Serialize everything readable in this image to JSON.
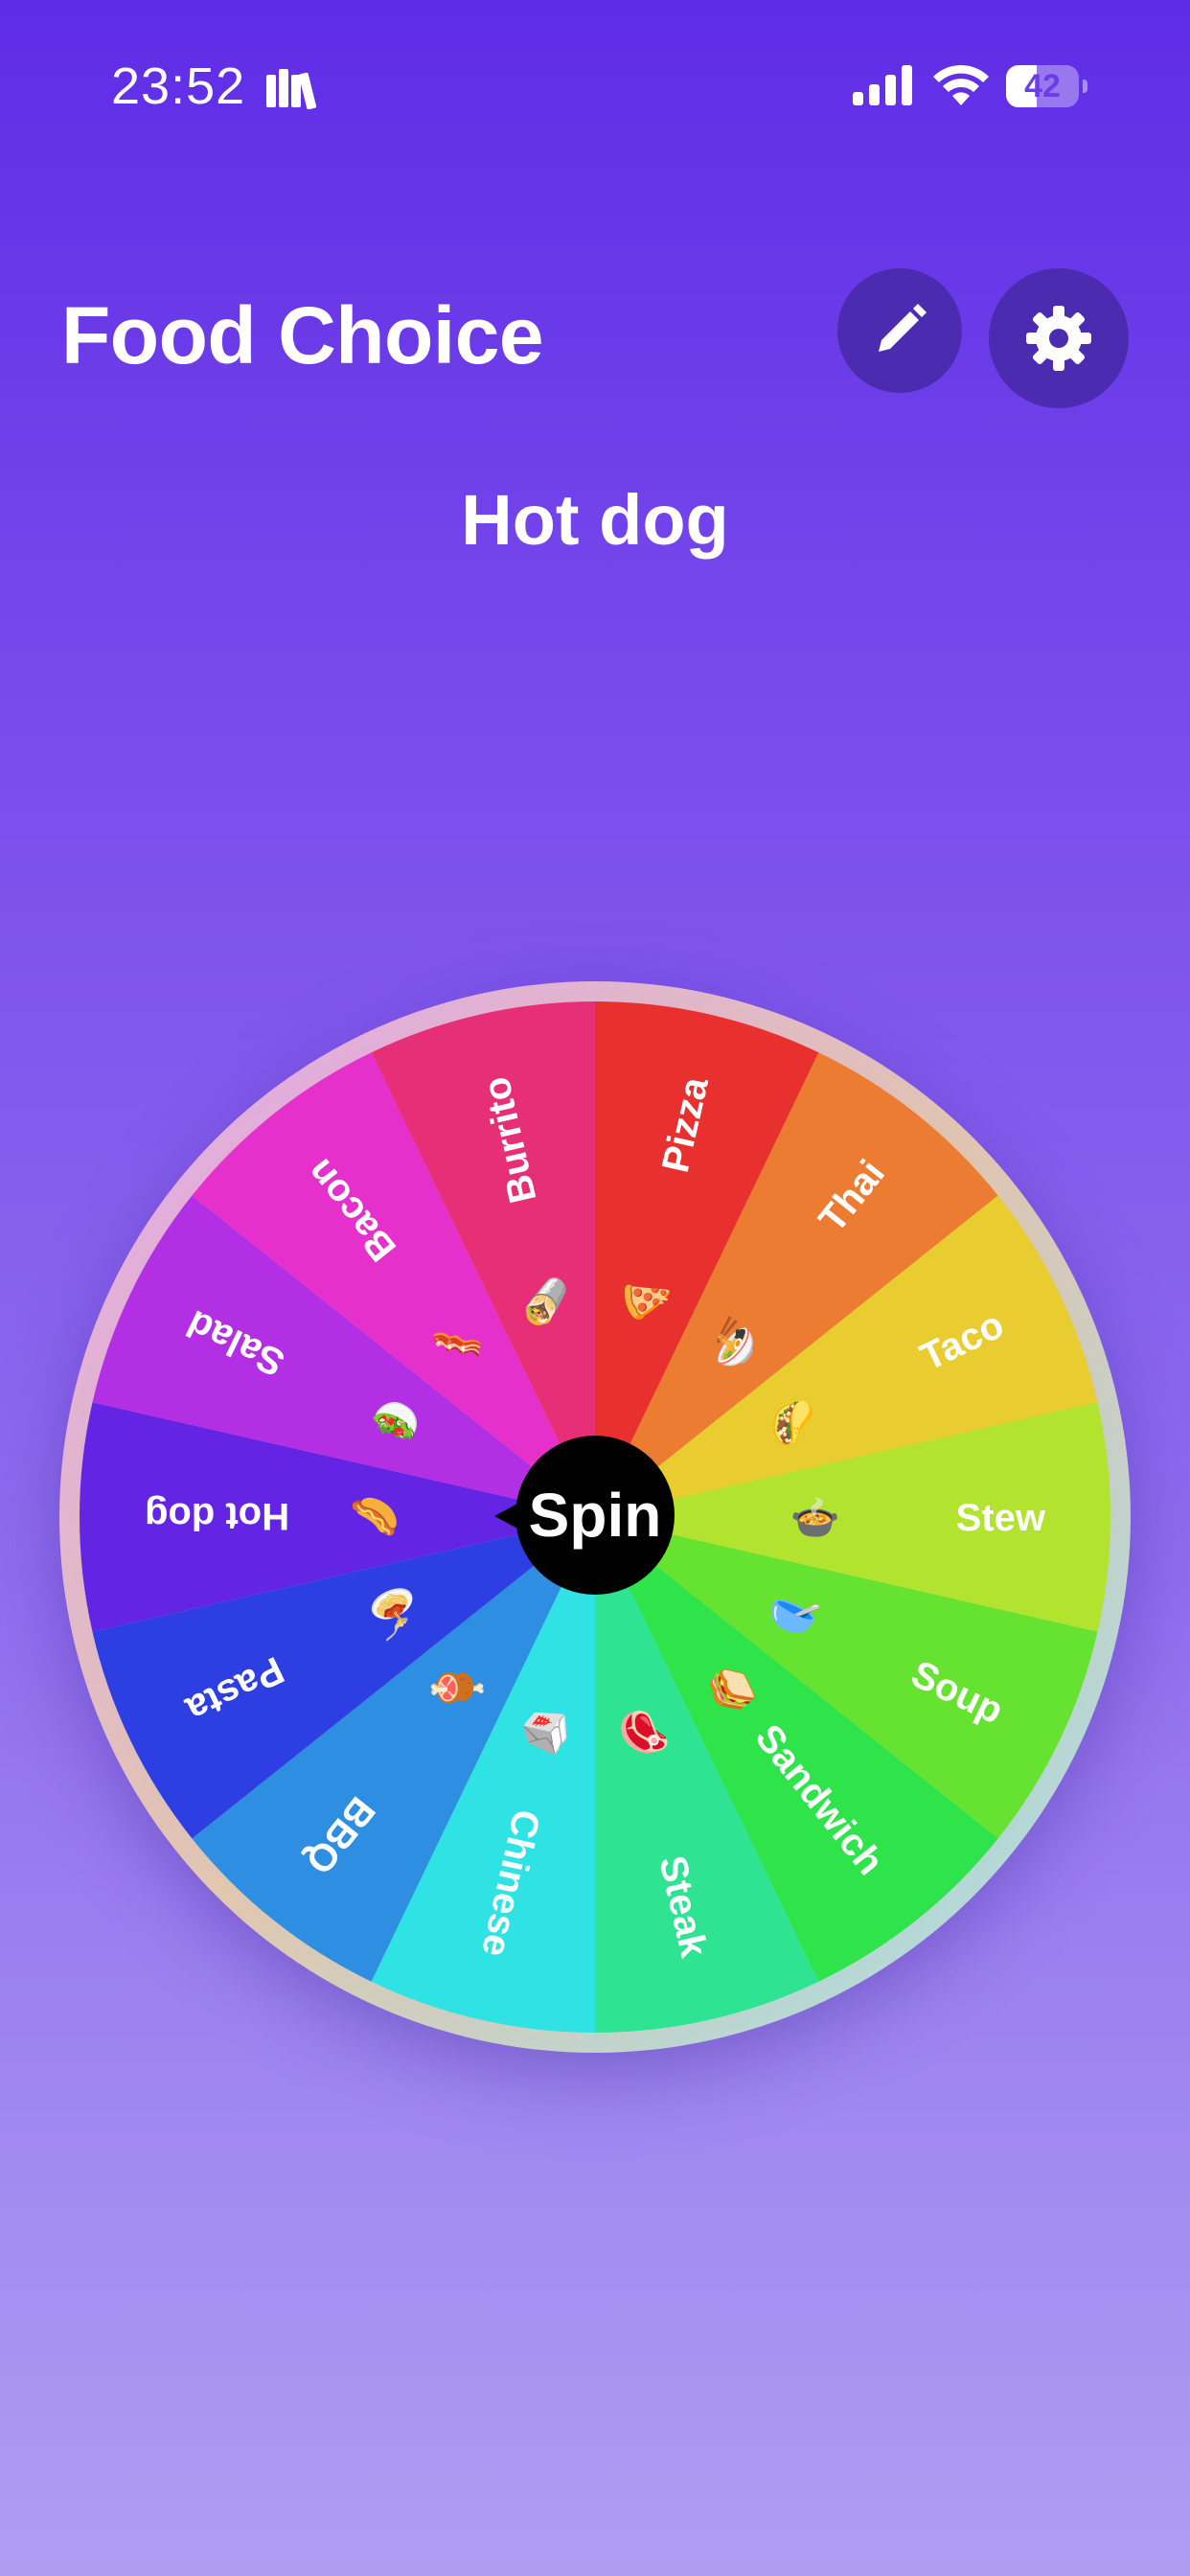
{
  "status_bar": {
    "time": "23:52",
    "battery_level": "42",
    "battery_fraction": 0.42,
    "icons": [
      "books-icon",
      "signal-icon",
      "wifi-icon",
      "battery-icon"
    ]
  },
  "header": {
    "title": "Food Choice",
    "edit_icon": "pencil-icon",
    "settings_icon": "gear-icon"
  },
  "result": {
    "text": "Hot dog"
  },
  "wheel": {
    "spin_label": "Spin",
    "segments": [
      {
        "label": "Pizza",
        "emoji": "🍕",
        "color": "#e8312e"
      },
      {
        "label": "Thai",
        "emoji": "🍜",
        "color": "#ec7c31"
      },
      {
        "label": "Taco",
        "emoji": "🌮",
        "color": "#e9cd30"
      },
      {
        "label": "Stew",
        "emoji": "🍲",
        "color": "#b2e32f"
      },
      {
        "label": "Soup",
        "emoji": "🥣",
        "color": "#66e231"
      },
      {
        "label": "Sandwich",
        "emoji": "🥪",
        "color": "#2fe44a"
      },
      {
        "label": "Steak",
        "emoji": "🥩",
        "color": "#2ee391"
      },
      {
        "label": "Chinese",
        "emoji": "🥡",
        "color": "#2fe2e3"
      },
      {
        "label": "BBQ",
        "emoji": "🍖",
        "color": "#2e8ee2"
      },
      {
        "label": "Pasta",
        "emoji": "🍝",
        "color": "#2d3fe2"
      },
      {
        "label": "Hot dog",
        "emoji": "🌭",
        "color": "#6325e3"
      },
      {
        "label": "Salad",
        "emoji": "🥗",
        "color": "#b22fe3"
      },
      {
        "label": "Bacon",
        "emoji": "🥓",
        "color": "#e630cb"
      },
      {
        "label": "Burrito",
        "emoji": "🌯",
        "color": "#e62f77"
      }
    ]
  }
}
